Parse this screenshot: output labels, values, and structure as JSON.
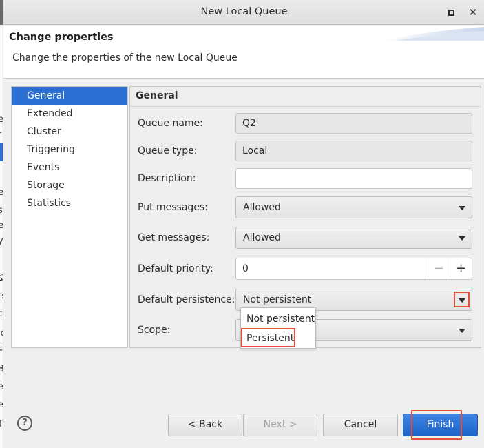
{
  "window": {
    "title": "New Local Queue"
  },
  "header": {
    "title": "Change properties",
    "description": "Change the properties of the new Local Queue"
  },
  "background_fragments": [
    "i",
    "e",
    "r",
    "a",
    "e",
    "s",
    "e",
    "y",
    "s",
    "D",
    "rs",
    "c",
    "ic",
    "F",
    "B",
    "e",
    "er",
    "T",
    "i"
  ],
  "nav": {
    "items": [
      "General",
      "Extended",
      "Cluster",
      "Triggering",
      "Events",
      "Storage",
      "Statistics"
    ],
    "selected_index": 0
  },
  "panel": {
    "title": "General",
    "queue_name": {
      "label": "Queue name:",
      "value": "Q2"
    },
    "queue_type": {
      "label": "Queue type:",
      "value": "Local"
    },
    "description": {
      "label": "Description:",
      "value": ""
    },
    "put_messages": {
      "label": "Put messages:",
      "value": "Allowed"
    },
    "get_messages": {
      "label": "Get messages:",
      "value": "Allowed"
    },
    "default_priority": {
      "label": "Default priority:",
      "value": "0",
      "minus": "−",
      "plus": "+"
    },
    "default_persistence": {
      "label": "Default persistence:",
      "value": "Not persistent"
    },
    "scope": {
      "label": "Scope:",
      "value": ""
    }
  },
  "persistence_options": [
    "Not persistent",
    "Persistent"
  ],
  "buttons": {
    "help": "?",
    "back": "< Back",
    "next": "Next >",
    "cancel": "Cancel",
    "finish": "Finish"
  },
  "colors": {
    "selection": "#2a6fd1",
    "highlight": "#e64e3a",
    "primary_button": "#2a6fd1"
  }
}
